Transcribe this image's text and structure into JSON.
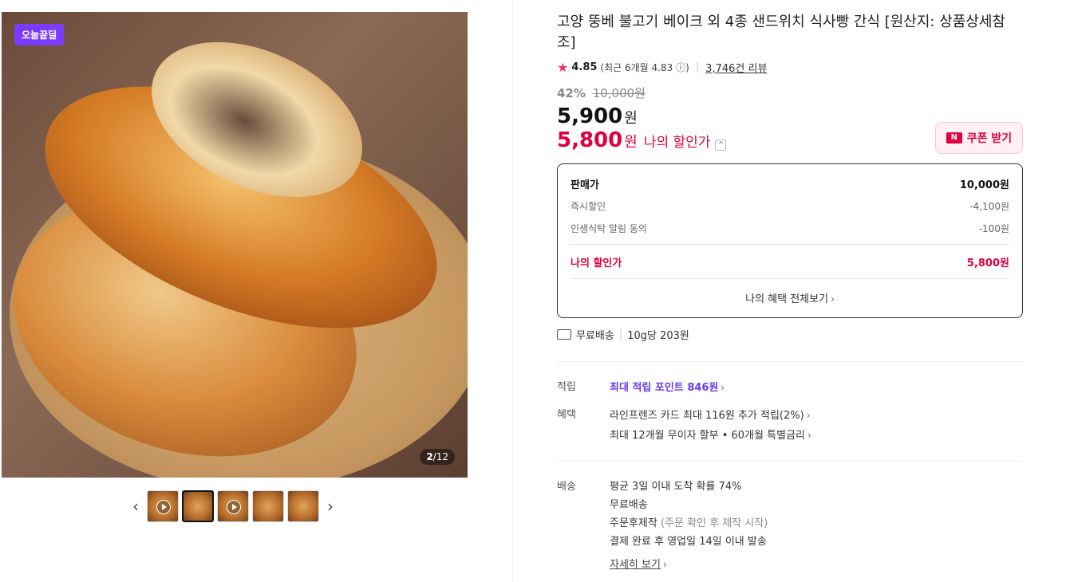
{
  "gallery": {
    "badge": "오늘끝딜",
    "counter_current": "2",
    "counter_total": "12",
    "prev_icon": "chevron-left-icon",
    "next_icon": "chevron-right-icon"
  },
  "product": {
    "title": "고양 뚱베 불고기 베이크 외 4종 샌드위치 식사빵 간식 [원산지: 상품상세참조]",
    "rating": "4.85",
    "recent_rating": "(최근 6개월 4.83",
    "recent_suffix": ")",
    "reviews": "3,746건 리뷰",
    "discount_pct": "42%",
    "original_price": "10,000원",
    "sale_price": "5,900",
    "won": "원",
    "my_price": "5,800",
    "my_price_label": "나의 할인가",
    "coupon_label": "쿠폰 받기",
    "coupon_badge": "N"
  },
  "breakdown": {
    "rows": [
      {
        "label": "판매가",
        "value": "10,000원"
      },
      {
        "label": "즉시할인",
        "value": "-4,100원"
      },
      {
        "label": "인생식탁 알림 동의",
        "value": "-100원"
      }
    ],
    "total_label": "나의 할인가",
    "total_value": "5,800원",
    "view_all": "나의 혜택 전체보기"
  },
  "shipping_summary": {
    "free": "무료배송",
    "unit_price": "10g당 203원"
  },
  "points": {
    "key": "적립",
    "value_prefix": "최대 적립 포인트 ",
    "value_amount": "846원"
  },
  "benefits": {
    "key": "혜택",
    "line1": "라인프렌즈 카드 최대 116원 추가 적립(2%)",
    "line2": "최대 12개월 무이자 할부 • 60개월 특별금리"
  },
  "delivery": {
    "key": "배송",
    "line1": "평균 3일 이내 도착 확률 74%",
    "line2": "무료배송",
    "line3_main": "주문후제작",
    "line3_note": "(주문 확인 후 제작 시작)",
    "line4": "결제 완료 후 영업일 14일 이내 발송",
    "details": "자세히 보기"
  }
}
